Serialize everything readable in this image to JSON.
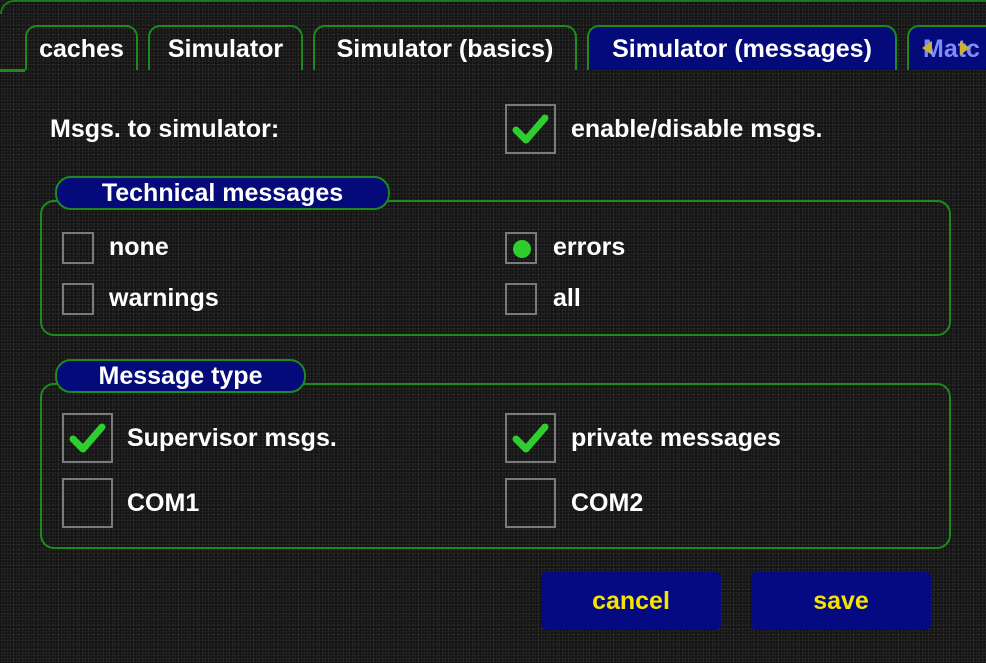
{
  "tabs": [
    {
      "label": "caches",
      "active": false
    },
    {
      "label": "Simulator",
      "active": false
    },
    {
      "label": "Simulator (basics)",
      "active": false
    },
    {
      "label": "Simulator (messages)",
      "active": true
    },
    {
      "label": "Matc",
      "active": false
    }
  ],
  "msgs_to_simulator": {
    "label": "Msgs. to simulator:",
    "toggle_label": "enable/disable msgs.",
    "checked": true
  },
  "technical_messages": {
    "title": "Technical messages",
    "options": [
      {
        "label": "none",
        "selected": false
      },
      {
        "label": "errors",
        "selected": true
      },
      {
        "label": "warnings",
        "selected": false
      },
      {
        "label": "all",
        "selected": false
      }
    ]
  },
  "message_type": {
    "title": "Message type",
    "options": [
      {
        "label": "Supervisor msgs.",
        "checked": true
      },
      {
        "label": "private messages",
        "checked": true
      },
      {
        "label": "COM1",
        "checked": false
      },
      {
        "label": "COM2",
        "checked": false
      }
    ]
  },
  "buttons": {
    "cancel": "cancel",
    "save": "save"
  },
  "colors": {
    "accent_green": "#1d8a1d",
    "active_blue": "#050a7a",
    "button_text_yellow": "#f5e400",
    "check_green": "#2fce2f"
  },
  "icons": {
    "check": "checkmark-icon",
    "scroll": "tab-scroll-arrows-icon"
  }
}
